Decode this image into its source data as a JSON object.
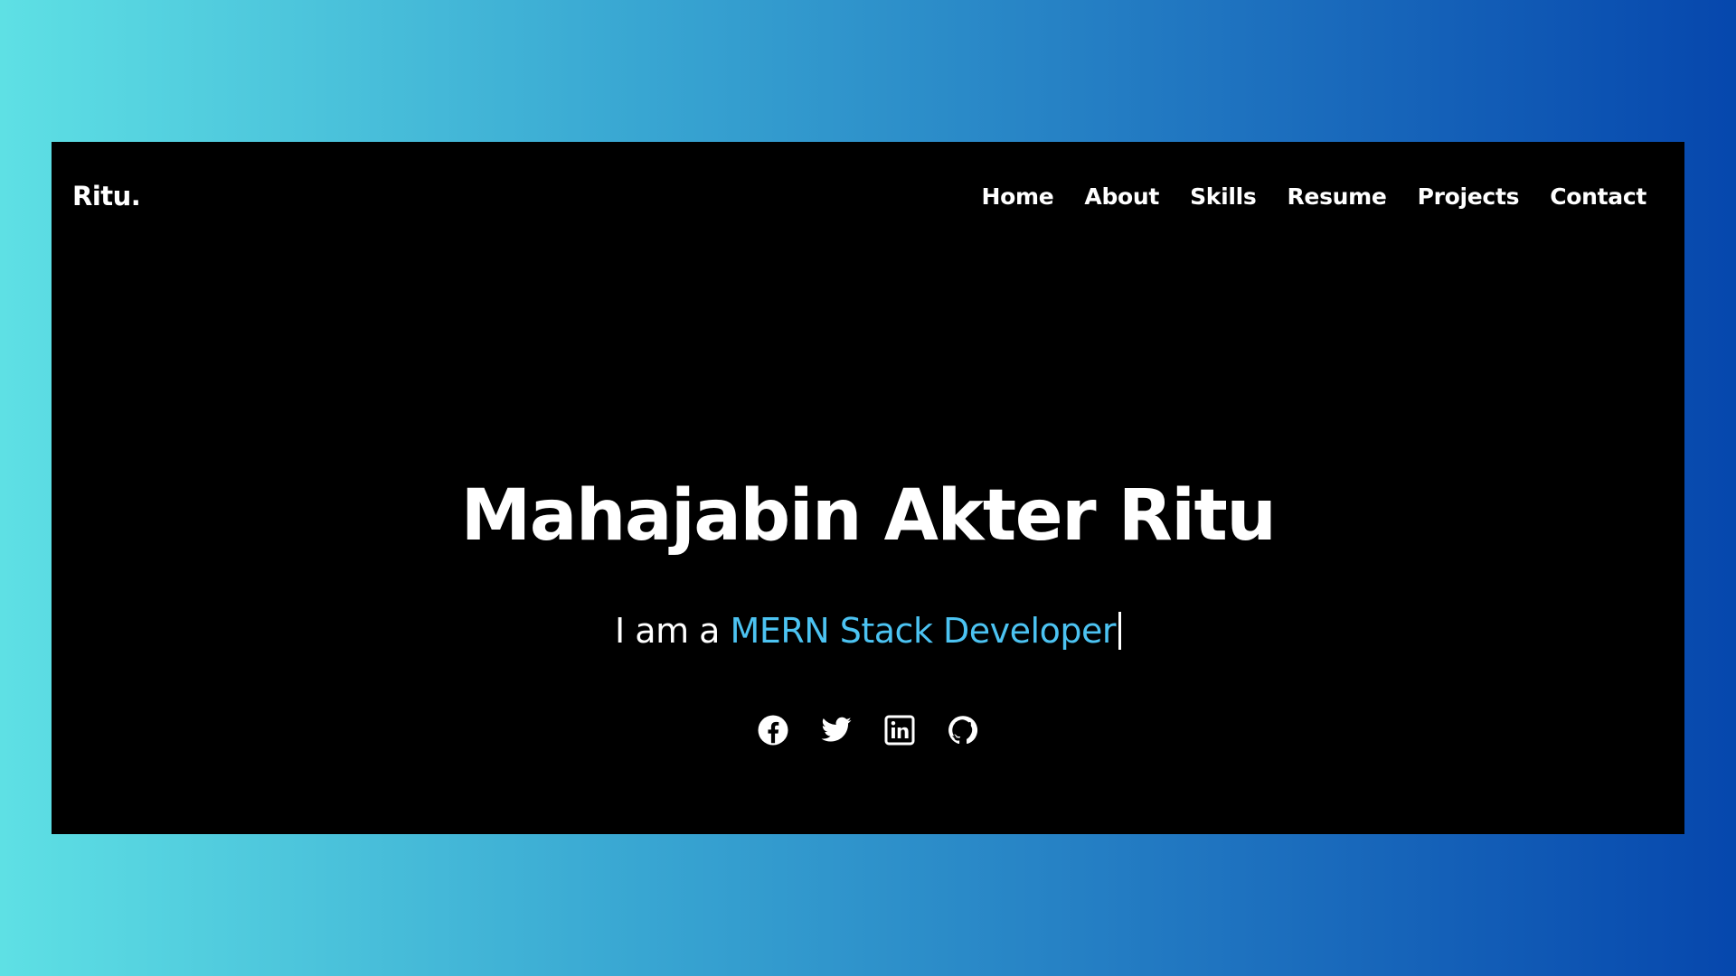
{
  "brand": {
    "logo": "Ritu."
  },
  "nav": {
    "items": [
      {
        "label": "Home"
      },
      {
        "label": "About"
      },
      {
        "label": "Skills"
      },
      {
        "label": "Resume"
      },
      {
        "label": "Projects"
      },
      {
        "label": "Contact"
      }
    ]
  },
  "hero": {
    "name": "Mahajabin Akter Ritu",
    "tagline_prefix": "I am a ",
    "tagline_role": "MERN Stack Developer"
  },
  "social": {
    "icons": [
      "facebook-icon",
      "twitter-icon",
      "linkedin-icon",
      "github-icon"
    ]
  },
  "colors": {
    "accent": "#4cc3f2",
    "background_frame": "#000000",
    "gradient_start": "#5ee0e4",
    "gradient_end": "#0647ad"
  }
}
